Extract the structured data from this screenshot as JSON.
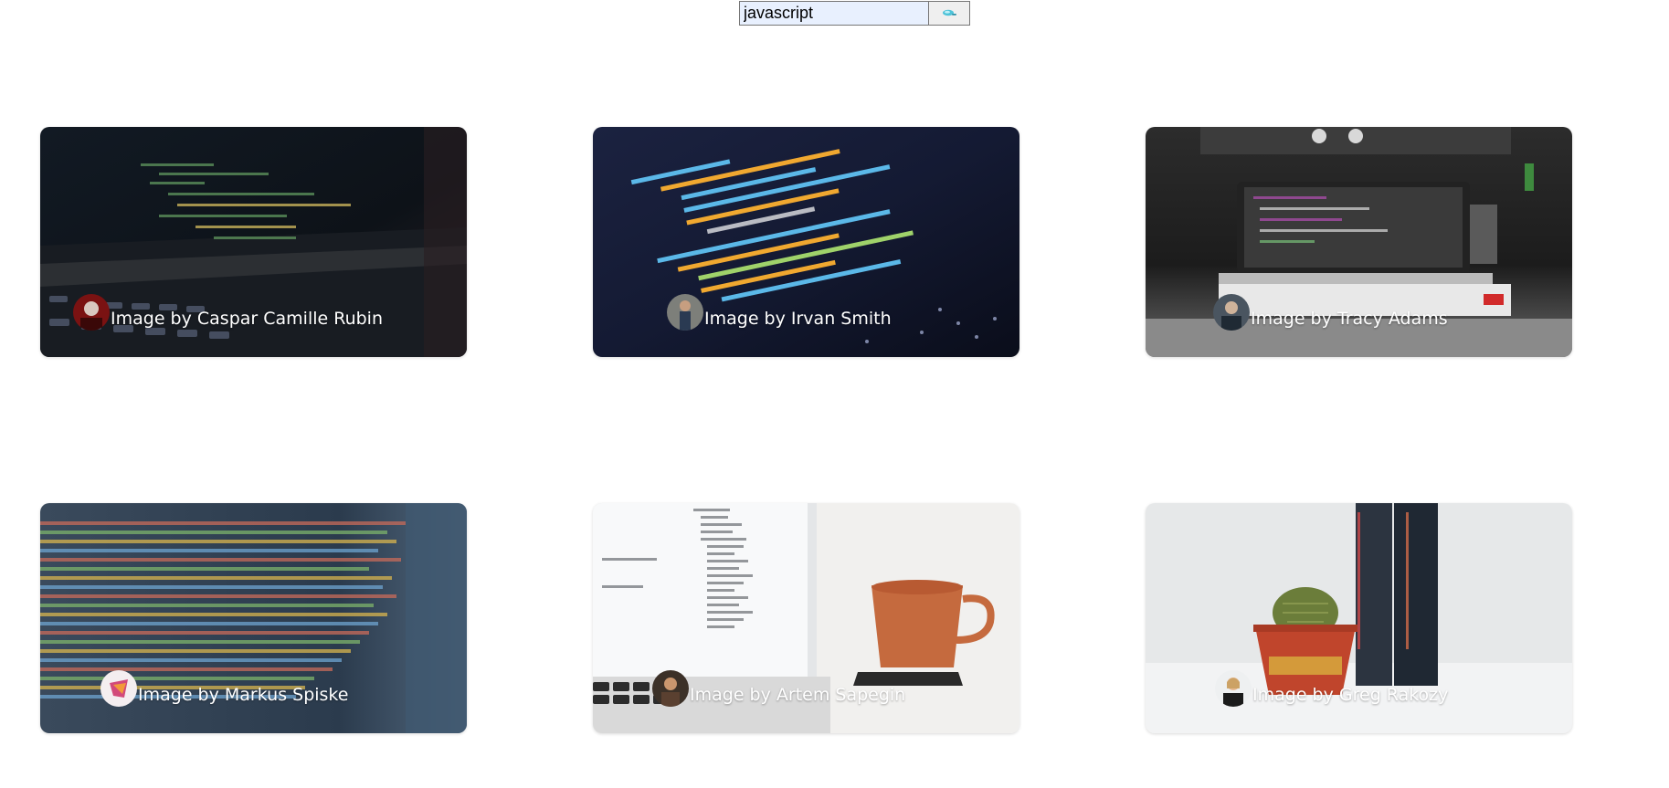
{
  "search": {
    "value": "javascript",
    "button_icon": "search-icon"
  },
  "gallery": {
    "cards": [
      {
        "credit": "Image by Caspar Camille Rubin",
        "scene": "laptop-code-dark"
      },
      {
        "credit": "Image by Irvan Smith",
        "scene": "screen-code-blue"
      },
      {
        "credit": "Image by Tracy Adams",
        "scene": "laptop-grayscale"
      },
      {
        "credit": "Image by Markus Spiske",
        "scene": "screen-code-colorful"
      },
      {
        "credit": "Image by Artem Sapegin",
        "scene": "laptop-coffee-cup"
      },
      {
        "credit": "Image by Greg Rakozy",
        "scene": "books-cactus"
      }
    ]
  },
  "colors": {
    "input_background": "#e8f0fe",
    "button_background": "#efefef",
    "search_icon": "#4fc3d9",
    "credit_text": "#ffffff"
  }
}
